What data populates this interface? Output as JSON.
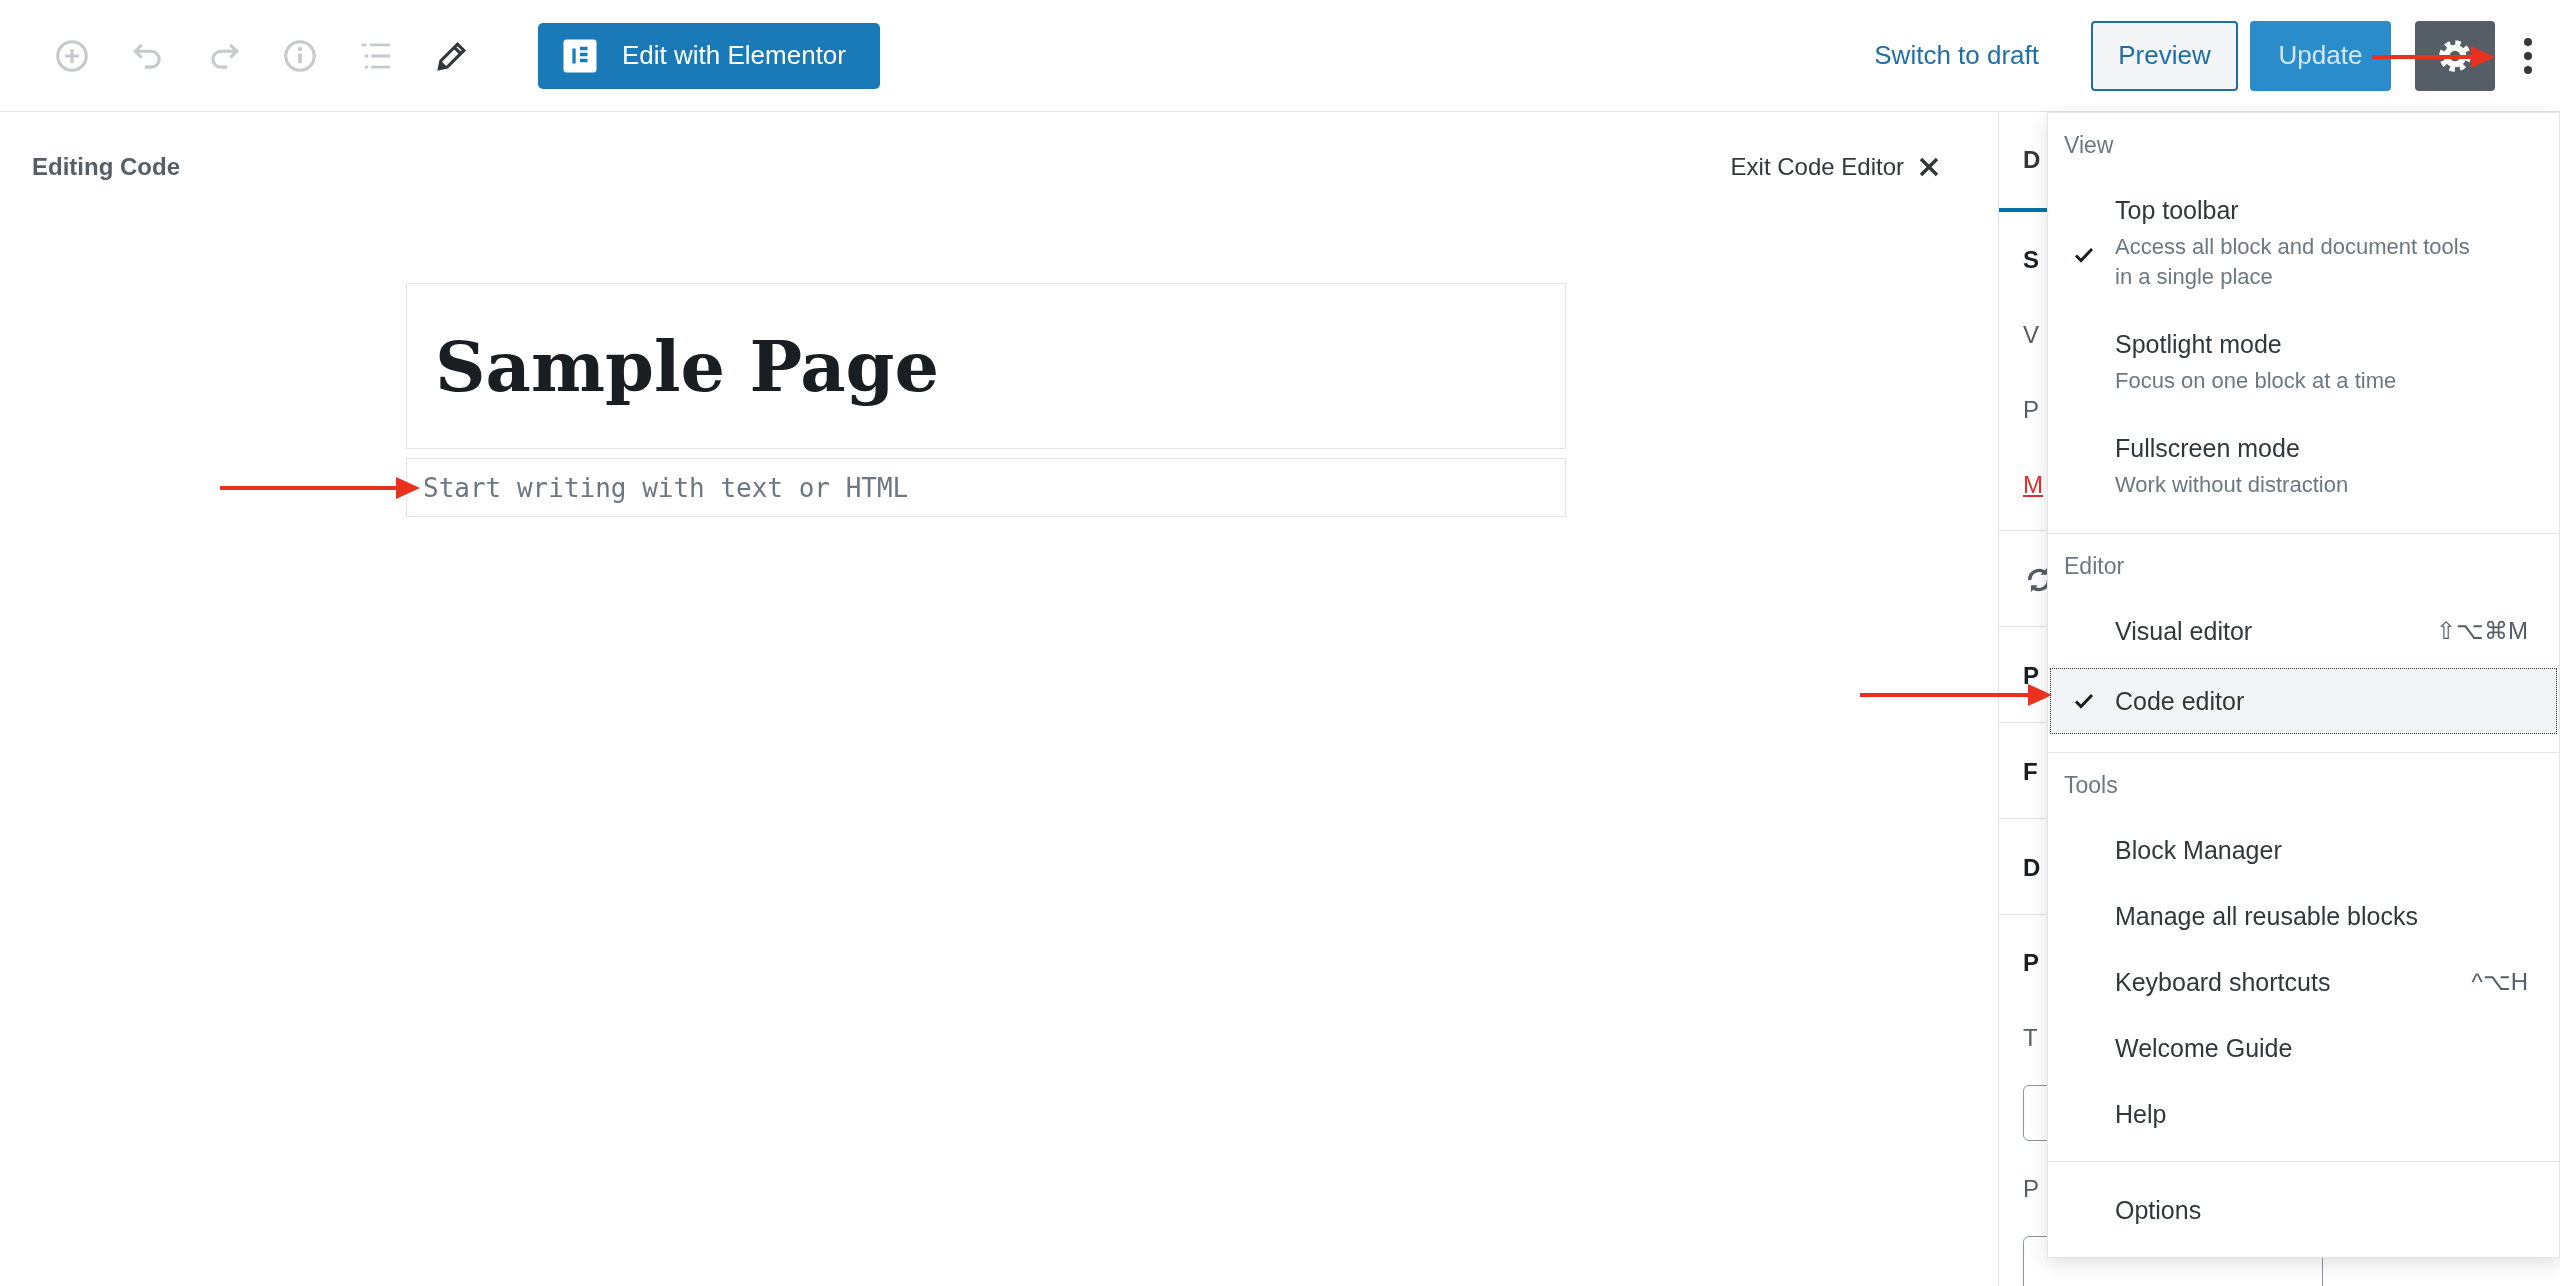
{
  "toolbar": {
    "tools": [
      {
        "kind": "add",
        "disabled": true
      },
      {
        "kind": "undo",
        "disabled": true
      },
      {
        "kind": "redo",
        "disabled": true
      },
      {
        "kind": "info",
        "disabled": true
      },
      {
        "kind": "outline",
        "disabled": true
      },
      {
        "kind": "edit",
        "disabled": false
      }
    ],
    "edit_button": "Edit with Elementor",
    "switch_to_draft": "Switch to draft",
    "preview": "Preview",
    "update": {
      "label": "Update",
      "disabled": true
    }
  },
  "editor": {
    "mode_label": "Editing Code",
    "exit": "Exit Code Editor",
    "title": "Sample Page",
    "body_placeholder": "Start writing with text or HTML"
  },
  "sidebar": {
    "tab": {
      "label": "D",
      "selected": true
    },
    "panels": [
      {
        "rows": [
          {
            "kind": "heading",
            "text": "S"
          },
          {
            "kind": "text",
            "text": "V"
          },
          {
            "kind": "text",
            "text": "P"
          },
          {
            "kind": "link",
            "text": "M"
          }
        ]
      },
      {
        "rows": [
          {
            "kind": "icon"
          }
        ]
      },
      {
        "rows": [
          {
            "kind": "heading",
            "text": "P"
          }
        ]
      },
      {
        "rows": [
          {
            "kind": "heading",
            "text": "F"
          }
        ]
      },
      {
        "rows": [
          {
            "kind": "heading",
            "text": "D"
          }
        ]
      },
      {
        "rows": [
          {
            "kind": "heading",
            "text": "P"
          },
          {
            "kind": "text",
            "text": "T"
          },
          {
            "kind": "field"
          },
          {
            "kind": "text",
            "text": "P"
          },
          {
            "kind": "field"
          }
        ]
      }
    ]
  },
  "menu": {
    "groups": [
      {
        "label": "View",
        "items": [
          {
            "label": "Top toolbar",
            "description": "Access all block and document tools in a single place",
            "checked": true,
            "selected": false
          },
          {
            "label": "Spotlight mode",
            "description": "Focus on one block at a time",
            "checked": false,
            "selected": false
          },
          {
            "label": "Fullscreen mode",
            "description": "Work without distraction",
            "checked": false,
            "selected": false
          }
        ]
      },
      {
        "label": "Editor",
        "items": [
          {
            "label": "Visual editor",
            "shortcut": "⇧⌥⌘M",
            "checked": false,
            "selected": false
          },
          {
            "label": "Code editor",
            "checked": true,
            "selected": true
          }
        ]
      },
      {
        "label": "Tools",
        "items": [
          {
            "label": "Block Manager",
            "checked": false,
            "selected": false
          },
          {
            "label": "Manage all reusable blocks",
            "checked": false,
            "selected": false
          },
          {
            "label": "Keyboard shortcuts",
            "shortcut": "^⌥H",
            "checked": false,
            "selected": false
          },
          {
            "label": "Welcome Guide",
            "checked": false,
            "selected": false
          },
          {
            "label": "Help",
            "checked": false,
            "selected": false
          }
        ]
      },
      {
        "items": [
          {
            "label": "Options",
            "checked": false,
            "selected": false
          }
        ]
      }
    ]
  }
}
